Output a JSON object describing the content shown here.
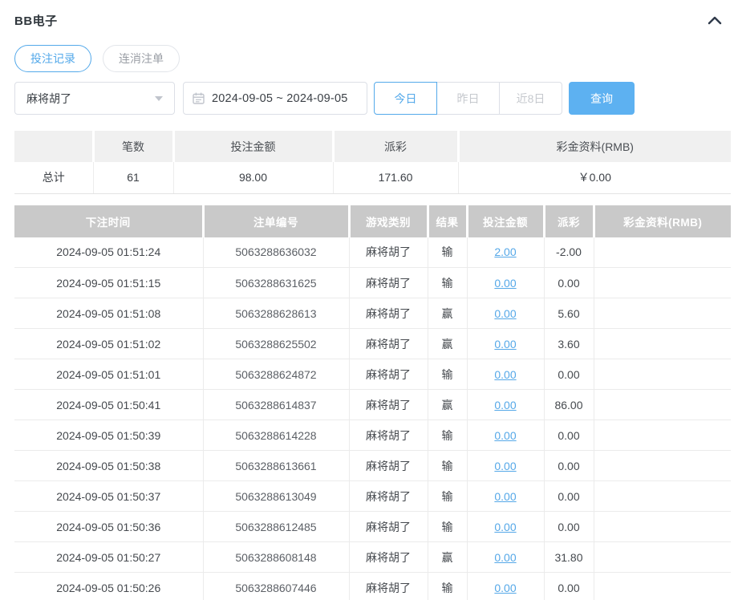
{
  "header": {
    "title": "BB电子"
  },
  "tabs": [
    {
      "label": "投注记录",
      "active": true
    },
    {
      "label": "连消注单",
      "active": false
    }
  ],
  "filters": {
    "game_select": {
      "value": "麻将胡了"
    },
    "date_range": {
      "value": "2024-09-05 ~ 2024-09-05"
    },
    "quick_ranges": [
      {
        "label": "今日",
        "active": true
      },
      {
        "label": "昨日",
        "active": false
      },
      {
        "label": "近8日",
        "active": false
      }
    ],
    "search_label": "查询"
  },
  "summary": {
    "headers": [
      "",
      "笔数",
      "投注金额",
      "派彩",
      "彩金资料(RMB)"
    ],
    "row": {
      "label": "总计",
      "count": "61",
      "bet_amount": "98.00",
      "payout": "171.60",
      "bonus": "￥0.00"
    }
  },
  "table": {
    "headers": [
      "下注时间",
      "注单编号",
      "游戏类别",
      "结果",
      "投注金额",
      "派彩",
      "彩金资料(RMB)"
    ],
    "rows": [
      {
        "time": "2024-09-05 01:51:24",
        "order_id": "5063288636032",
        "game": "麻将胡了",
        "result": "输",
        "bet": "2.00",
        "payout": "-2.00",
        "bonus": ""
      },
      {
        "time": "2024-09-05 01:51:15",
        "order_id": "5063288631625",
        "game": "麻将胡了",
        "result": "输",
        "bet": "0.00",
        "payout": "0.00",
        "bonus": ""
      },
      {
        "time": "2024-09-05 01:51:08",
        "order_id": "5063288628613",
        "game": "麻将胡了",
        "result": "赢",
        "bet": "0.00",
        "payout": "5.60",
        "bonus": ""
      },
      {
        "time": "2024-09-05 01:51:02",
        "order_id": "5063288625502",
        "game": "麻将胡了",
        "result": "赢",
        "bet": "0.00",
        "payout": "3.60",
        "bonus": ""
      },
      {
        "time": "2024-09-05 01:51:01",
        "order_id": "5063288624872",
        "game": "麻将胡了",
        "result": "输",
        "bet": "0.00",
        "payout": "0.00",
        "bonus": ""
      },
      {
        "time": "2024-09-05 01:50:41",
        "order_id": "5063288614837",
        "game": "麻将胡了",
        "result": "赢",
        "bet": "0.00",
        "payout": "86.00",
        "bonus": ""
      },
      {
        "time": "2024-09-05 01:50:39",
        "order_id": "5063288614228",
        "game": "麻将胡了",
        "result": "输",
        "bet": "0.00",
        "payout": "0.00",
        "bonus": ""
      },
      {
        "time": "2024-09-05 01:50:38",
        "order_id": "5063288613661",
        "game": "麻将胡了",
        "result": "输",
        "bet": "0.00",
        "payout": "0.00",
        "bonus": ""
      },
      {
        "time": "2024-09-05 01:50:37",
        "order_id": "5063288613049",
        "game": "麻将胡了",
        "result": "输",
        "bet": "0.00",
        "payout": "0.00",
        "bonus": ""
      },
      {
        "time": "2024-09-05 01:50:36",
        "order_id": "5063288612485",
        "game": "麻将胡了",
        "result": "输",
        "bet": "0.00",
        "payout": "0.00",
        "bonus": ""
      },
      {
        "time": "2024-09-05 01:50:27",
        "order_id": "5063288608148",
        "game": "麻将胡了",
        "result": "赢",
        "bet": "0.00",
        "payout": "31.80",
        "bonus": ""
      },
      {
        "time": "2024-09-05 01:50:26",
        "order_id": "5063288607446",
        "game": "麻将胡了",
        "result": "输",
        "bet": "0.00",
        "payout": "0.00",
        "bonus": ""
      }
    ]
  },
  "colors": {
    "accent": "#54a9ea",
    "search_button": "#5db1f1",
    "negative": "#f25b5b",
    "table_header_bg": "#c9c9c9",
    "summary_header_bg": "#f0f0f0"
  }
}
